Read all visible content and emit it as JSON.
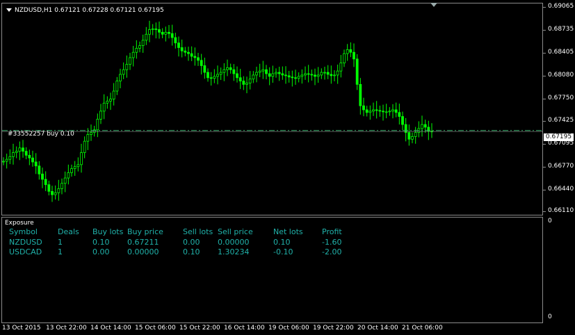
{
  "header": {
    "symbol_line": "NZDUSD,H1  0.67121 0.67228 0.67121 0.67195"
  },
  "trade_line": {
    "label": "#33552257 buy 0.10",
    "price": 0.67211,
    "color": "#3cb371"
  },
  "price_axis": {
    "ticks": [
      "0.69065",
      "0.68735",
      "0.68405",
      "0.68080",
      "0.67750",
      "0.67425",
      "0.67095",
      "0.66770",
      "0.66440",
      "0.66110"
    ],
    "current_price": "0.67195"
  },
  "sub_axis": {
    "top": "0",
    "bottom": "0"
  },
  "exposure": {
    "title": "Exposure",
    "headers": [
      "Symbol",
      "Deals",
      "Buy lots",
      "Buy price",
      "Sell lots",
      "Sell price",
      "Net lots",
      "Profit"
    ],
    "rows": [
      [
        "NZDUSD",
        "1",
        "0.10",
        "0.67211",
        "0.00",
        "0.00000",
        "0.10",
        "-1.60"
      ],
      [
        "USDCAD",
        "1",
        "0.00",
        "0.00000",
        "0.10",
        "1.30234",
        "-0.10",
        "-2.00"
      ]
    ]
  },
  "time_axis": [
    "13 Oct 2015",
    "13 Oct 22:00",
    "14 Oct 14:00",
    "15 Oct 06:00",
    "15 Oct 22:00",
    "16 Oct 14:00",
    "19 Oct 06:00",
    "19 Oct 22:00",
    "20 Oct 14:00",
    "21 Oct 06:00"
  ],
  "colors": {
    "background": "#000000",
    "candle": "#00ff00",
    "grid_border": "#8c8c8c",
    "exposure_text": "#20b2aa"
  },
  "chart_data": {
    "type": "candlestick",
    "ylim": [
      0.6595,
      0.6911
    ],
    "close_series": [
      0.6675,
      0.6678,
      0.6682,
      0.6688,
      0.669,
      0.6695,
      0.669,
      0.6684,
      0.668,
      0.6674,
      0.6668,
      0.6656,
      0.6648,
      0.664,
      0.663,
      0.6625,
      0.6628,
      0.6634,
      0.6642,
      0.665,
      0.6658,
      0.6664,
      0.6667,
      0.667,
      0.6688,
      0.6705,
      0.6715,
      0.6718,
      0.6722,
      0.6738,
      0.675,
      0.6762,
      0.6765,
      0.6768,
      0.678,
      0.6795,
      0.6805,
      0.6812,
      0.682,
      0.683,
      0.6838,
      0.6844,
      0.6848,
      0.6856,
      0.6865,
      0.6872,
      0.6873,
      0.6872,
      0.6868,
      0.6865,
      0.6868,
      0.6866,
      0.686,
      0.6852,
      0.6845,
      0.684,
      0.6838,
      0.6836,
      0.6832,
      0.683,
      0.6826,
      0.6818,
      0.6808,
      0.68,
      0.6799,
      0.6802,
      0.6805,
      0.6808,
      0.6812,
      0.6815,
      0.6812,
      0.6806,
      0.68,
      0.6795,
      0.679,
      0.6792,
      0.6798,
      0.6804,
      0.6808,
      0.681,
      0.6812,
      0.6806,
      0.6802,
      0.6806,
      0.6808,
      0.6806,
      0.6804,
      0.6803,
      0.6801,
      0.68,
      0.6799,
      0.6802,
      0.6804,
      0.6806,
      0.6805,
      0.6804,
      0.6802,
      0.6804,
      0.6808,
      0.6808,
      0.6805,
      0.6803,
      0.6804,
      0.681,
      0.6822,
      0.6836,
      0.6842,
      0.6838,
      0.6828,
      0.679,
      0.6758,
      0.6752,
      0.6748,
      0.675,
      0.6752,
      0.6751,
      0.675,
      0.6749,
      0.6749,
      0.675,
      0.6752,
      0.6748,
      0.6742,
      0.673,
      0.6718,
      0.6708,
      0.6712,
      0.6718,
      0.6724,
      0.673,
      0.6726,
      0.672,
      0.67195
    ]
  }
}
